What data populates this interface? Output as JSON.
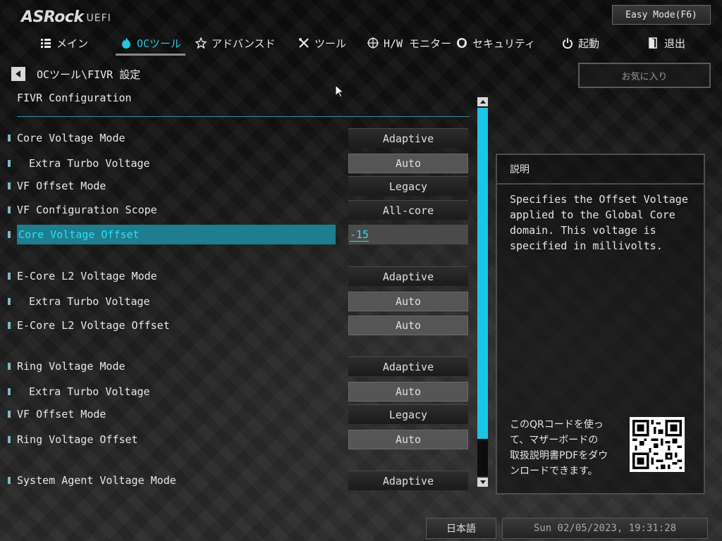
{
  "header": {
    "logo_main": "ASRock",
    "logo_sub": "UEFI",
    "easy_mode_label": "Easy Mode(F6)"
  },
  "tabs": [
    {
      "label": "メイン",
      "icon": "list-icon"
    },
    {
      "label": "OCツール",
      "icon": "flame-icon",
      "active": true
    },
    {
      "label": "アドバンスド",
      "icon": "star-icon"
    },
    {
      "label": "ツール",
      "icon": "tools-icon"
    },
    {
      "label": "H/W モニター",
      "icon": "crosshair-icon"
    },
    {
      "label": "セキュリティ",
      "icon": "shield-icon"
    },
    {
      "label": "起動",
      "icon": "power-icon"
    },
    {
      "label": "退出",
      "icon": "exit-icon"
    }
  ],
  "breadcrumb": "OCツール\\FIVR 設定",
  "favorite_label": "お気に入り",
  "section_title": "FIVR Configuration",
  "settings": [
    {
      "label": "Core Voltage Mode",
      "value": "Adaptive"
    },
    {
      "label": "Extra Turbo Voltage",
      "value": "Auto"
    },
    {
      "label": "VF Offset Mode",
      "value": "Legacy"
    },
    {
      "label": "VF Configuration Scope",
      "value": "All-core"
    },
    {
      "label": "Core Voltage Offset",
      "value": "-15"
    },
    {
      "label": "E-Core L2 Voltage Mode",
      "value": "Adaptive"
    },
    {
      "label": "Extra Turbo Voltage",
      "value": "Auto"
    },
    {
      "label": "E-Core L2 Voltage Offset",
      "value": "Auto"
    },
    {
      "label": "Ring Voltage Mode",
      "value": "Adaptive"
    },
    {
      "label": "Extra Turbo Voltage",
      "value": "Auto"
    },
    {
      "label": "VF Offset Mode",
      "value": "Legacy"
    },
    {
      "label": "Ring Voltage Offset",
      "value": "Auto"
    },
    {
      "label": "System Agent Voltage Mode",
      "value": "Adaptive"
    }
  ],
  "description": {
    "title": "説明",
    "text": "Specifies the Offset Voltage\napplied to the Global Core\ndomain. This voltage is\nspecified in millivolts.",
    "qr_text": "このQRコードを使っ\nて、マザーボードの\n取扱説明書PDFをダウ\nンロードできます。"
  },
  "footer": {
    "language": "日本語",
    "datetime": "Sun 02/05/2023, 19:31:28"
  },
  "colors": {
    "accent": "#25c6e0",
    "selection": "#1e7d8e",
    "scroll_thumb": "#1ec4e4"
  }
}
